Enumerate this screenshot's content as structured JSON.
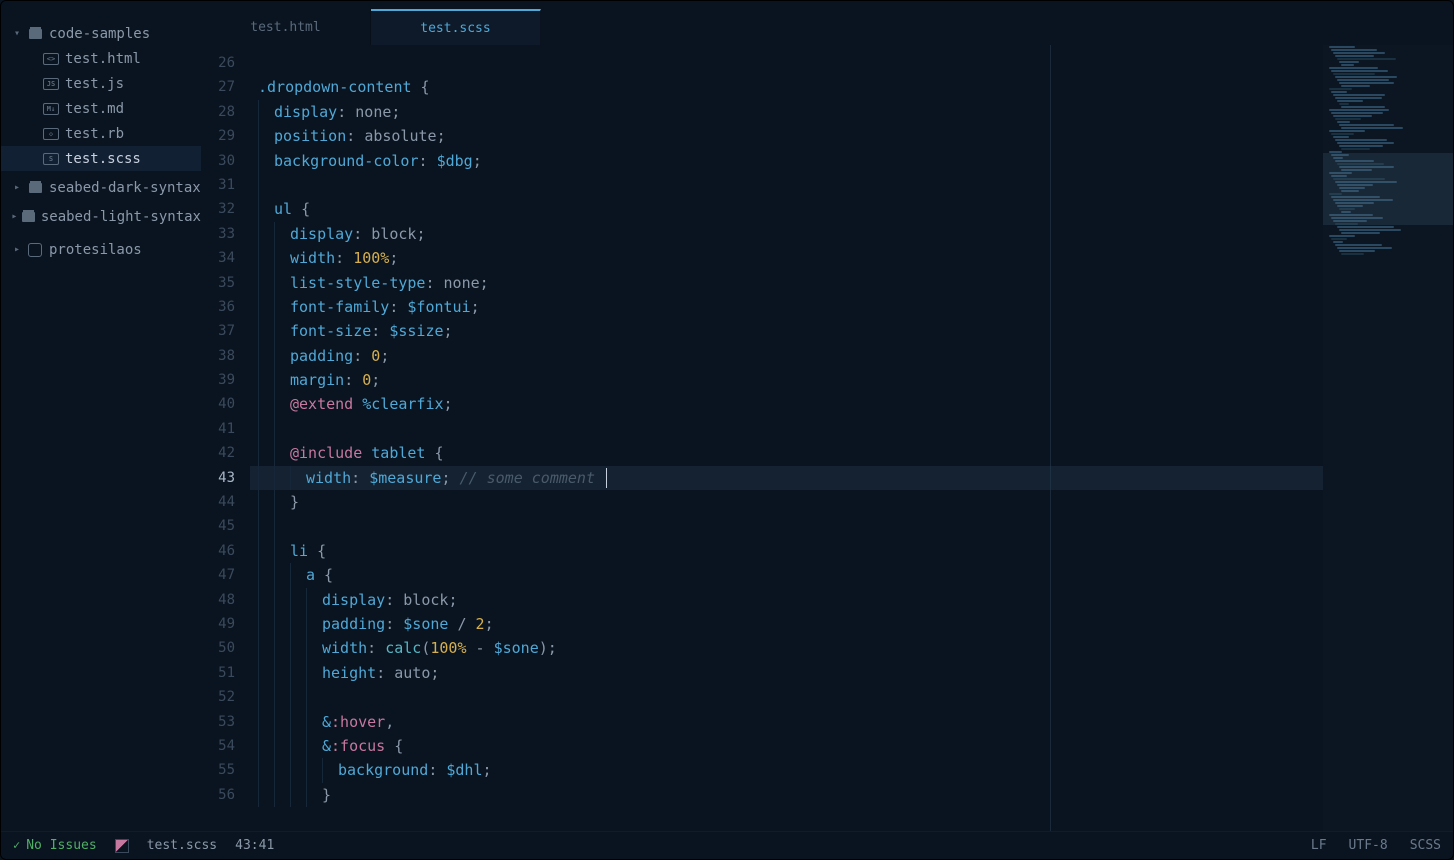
{
  "sidebar": {
    "root": {
      "label": "code-samples",
      "expanded": true
    },
    "files": [
      {
        "label": "test.html",
        "badge": "<>"
      },
      {
        "label": "test.js",
        "badge": "JS"
      },
      {
        "label": "test.md",
        "badge": "M↓"
      },
      {
        "label": "test.rb",
        "badge": "◇"
      },
      {
        "label": "test.scss",
        "badge": "S",
        "active": true
      }
    ],
    "folders": [
      {
        "label": "seabed-dark-syntax"
      },
      {
        "label": "seabed-light-syntax"
      }
    ],
    "repo": {
      "label": "protesilaos"
    }
  },
  "tabs": [
    {
      "label": "test.html",
      "active": false
    },
    {
      "label": "test.scss",
      "active": true
    }
  ],
  "editor": {
    "first_line_no": 26,
    "current_line_no": 43,
    "lines": [
      {
        "n": 26,
        "indent": 0,
        "tokens": []
      },
      {
        "n": 27,
        "indent": 0,
        "tokens": [
          {
            "c": "tok-selector",
            "t": ".dropdown-content"
          },
          {
            "c": "tok-punc",
            "t": " {"
          }
        ]
      },
      {
        "n": 28,
        "indent": 1,
        "tokens": [
          {
            "c": "tok-prop",
            "t": "display"
          },
          {
            "c": "tok-punc",
            "t": ": "
          },
          {
            "c": "tok-value",
            "t": "none"
          },
          {
            "c": "tok-punc",
            "t": ";"
          }
        ]
      },
      {
        "n": 29,
        "indent": 1,
        "tokens": [
          {
            "c": "tok-prop",
            "t": "position"
          },
          {
            "c": "tok-punc",
            "t": ": "
          },
          {
            "c": "tok-value",
            "t": "absolute"
          },
          {
            "c": "tok-punc",
            "t": ";"
          }
        ]
      },
      {
        "n": 30,
        "indent": 1,
        "tokens": [
          {
            "c": "tok-prop",
            "t": "background-color"
          },
          {
            "c": "tok-punc",
            "t": ": "
          },
          {
            "c": "tok-var",
            "t": "$dbg"
          },
          {
            "c": "tok-punc",
            "t": ";"
          }
        ]
      },
      {
        "n": 31,
        "indent": 1,
        "tokens": []
      },
      {
        "n": 32,
        "indent": 1,
        "tokens": [
          {
            "c": "tok-selector",
            "t": "ul"
          },
          {
            "c": "tok-punc",
            "t": " {"
          }
        ]
      },
      {
        "n": 33,
        "indent": 2,
        "tokens": [
          {
            "c": "tok-prop",
            "t": "display"
          },
          {
            "c": "tok-punc",
            "t": ": "
          },
          {
            "c": "tok-value",
            "t": "block"
          },
          {
            "c": "tok-punc",
            "t": ";"
          }
        ]
      },
      {
        "n": 34,
        "indent": 2,
        "tokens": [
          {
            "c": "tok-prop",
            "t": "width"
          },
          {
            "c": "tok-punc",
            "t": ": "
          },
          {
            "c": "tok-num",
            "t": "100%"
          },
          {
            "c": "tok-punc",
            "t": ";"
          }
        ]
      },
      {
        "n": 35,
        "indent": 2,
        "tokens": [
          {
            "c": "tok-prop",
            "t": "list-style-type"
          },
          {
            "c": "tok-punc",
            "t": ": "
          },
          {
            "c": "tok-value",
            "t": "none"
          },
          {
            "c": "tok-punc",
            "t": ";"
          }
        ]
      },
      {
        "n": 36,
        "indent": 2,
        "tokens": [
          {
            "c": "tok-prop",
            "t": "font-family"
          },
          {
            "c": "tok-punc",
            "t": ": "
          },
          {
            "c": "tok-var",
            "t": "$fontui"
          },
          {
            "c": "tok-punc",
            "t": ";"
          }
        ]
      },
      {
        "n": 37,
        "indent": 2,
        "tokens": [
          {
            "c": "tok-prop",
            "t": "font-size"
          },
          {
            "c": "tok-punc",
            "t": ": "
          },
          {
            "c": "tok-var",
            "t": "$ssize"
          },
          {
            "c": "tok-punc",
            "t": ";"
          }
        ]
      },
      {
        "n": 38,
        "indent": 2,
        "tokens": [
          {
            "c": "tok-prop",
            "t": "padding"
          },
          {
            "c": "tok-punc",
            "t": ": "
          },
          {
            "c": "tok-num",
            "t": "0"
          },
          {
            "c": "tok-punc",
            "t": ";"
          }
        ]
      },
      {
        "n": 39,
        "indent": 2,
        "tokens": [
          {
            "c": "tok-prop",
            "t": "margin"
          },
          {
            "c": "tok-punc",
            "t": ": "
          },
          {
            "c": "tok-num",
            "t": "0"
          },
          {
            "c": "tok-punc",
            "t": ";"
          }
        ]
      },
      {
        "n": 40,
        "indent": 2,
        "tokens": [
          {
            "c": "tok-keyword",
            "t": "@extend"
          },
          {
            "c": "tok-punc",
            "t": " "
          },
          {
            "c": "tok-var",
            "t": "%clearfix"
          },
          {
            "c": "tok-punc",
            "t": ";"
          }
        ]
      },
      {
        "n": 41,
        "indent": 2,
        "tokens": []
      },
      {
        "n": 42,
        "indent": 2,
        "tokens": [
          {
            "c": "tok-keyword",
            "t": "@include"
          },
          {
            "c": "tok-punc",
            "t": " "
          },
          {
            "c": "tok-selector",
            "t": "tablet"
          },
          {
            "c": "tok-punc",
            "t": " {"
          }
        ]
      },
      {
        "n": 43,
        "indent": 3,
        "tokens": [
          {
            "c": "tok-prop",
            "t": "width"
          },
          {
            "c": "tok-punc",
            "t": ": "
          },
          {
            "c": "tok-var",
            "t": "$measure"
          },
          {
            "c": "tok-punc",
            "t": "; "
          },
          {
            "c": "tok-comment",
            "t": "// some comment "
          }
        ],
        "caret": true
      },
      {
        "n": 44,
        "indent": 2,
        "tokens": [
          {
            "c": "tok-punc",
            "t": "}"
          }
        ]
      },
      {
        "n": 45,
        "indent": 2,
        "tokens": []
      },
      {
        "n": 46,
        "indent": 2,
        "tokens": [
          {
            "c": "tok-selector",
            "t": "li"
          },
          {
            "c": "tok-punc",
            "t": " {"
          }
        ]
      },
      {
        "n": 47,
        "indent": 3,
        "tokens": [
          {
            "c": "tok-selector",
            "t": "a"
          },
          {
            "c": "tok-punc",
            "t": " {"
          }
        ]
      },
      {
        "n": 48,
        "indent": 4,
        "tokens": [
          {
            "c": "tok-prop",
            "t": "display"
          },
          {
            "c": "tok-punc",
            "t": ": "
          },
          {
            "c": "tok-value",
            "t": "block"
          },
          {
            "c": "tok-punc",
            "t": ";"
          }
        ]
      },
      {
        "n": 49,
        "indent": 4,
        "tokens": [
          {
            "c": "tok-prop",
            "t": "padding"
          },
          {
            "c": "tok-punc",
            "t": ": "
          },
          {
            "c": "tok-var",
            "t": "$sone"
          },
          {
            "c": "tok-punc",
            "t": " / "
          },
          {
            "c": "tok-num",
            "t": "2"
          },
          {
            "c": "tok-punc",
            "t": ";"
          }
        ]
      },
      {
        "n": 50,
        "indent": 4,
        "tokens": [
          {
            "c": "tok-prop",
            "t": "width"
          },
          {
            "c": "tok-punc",
            "t": ": "
          },
          {
            "c": "tok-func",
            "t": "calc"
          },
          {
            "c": "tok-punc",
            "t": "("
          },
          {
            "c": "tok-num",
            "t": "100%"
          },
          {
            "c": "tok-punc",
            "t": " - "
          },
          {
            "c": "tok-var",
            "t": "$sone"
          },
          {
            "c": "tok-punc",
            "t": ");"
          }
        ]
      },
      {
        "n": 51,
        "indent": 4,
        "tokens": [
          {
            "c": "tok-prop",
            "t": "height"
          },
          {
            "c": "tok-punc",
            "t": ": "
          },
          {
            "c": "tok-value",
            "t": "auto"
          },
          {
            "c": "tok-punc",
            "t": ";"
          }
        ]
      },
      {
        "n": 52,
        "indent": 4,
        "tokens": []
      },
      {
        "n": 53,
        "indent": 4,
        "tokens": [
          {
            "c": "tok-selector",
            "t": "&"
          },
          {
            "c": "tok-pseudo",
            "t": ":hover"
          },
          {
            "c": "tok-punc",
            "t": ","
          }
        ]
      },
      {
        "n": 54,
        "indent": 4,
        "tokens": [
          {
            "c": "tok-selector",
            "t": "&"
          },
          {
            "c": "tok-pseudo",
            "t": ":focus"
          },
          {
            "c": "tok-punc",
            "t": " {"
          }
        ]
      },
      {
        "n": 55,
        "indent": 5,
        "tokens": [
          {
            "c": "tok-prop",
            "t": "background"
          },
          {
            "c": "tok-punc",
            "t": ": "
          },
          {
            "c": "tok-var",
            "t": "$dhl"
          },
          {
            "c": "tok-punc",
            "t": ";"
          }
        ]
      },
      {
        "n": 56,
        "indent": 4,
        "tokens": [
          {
            "c": "tok-punc",
            "t": "}"
          }
        ]
      }
    ]
  },
  "statusbar": {
    "issues": "No Issues",
    "file": "test.scss",
    "cursor": "43:41",
    "line_ending": "LF",
    "encoding": "UTF-8",
    "language": "SCSS"
  }
}
